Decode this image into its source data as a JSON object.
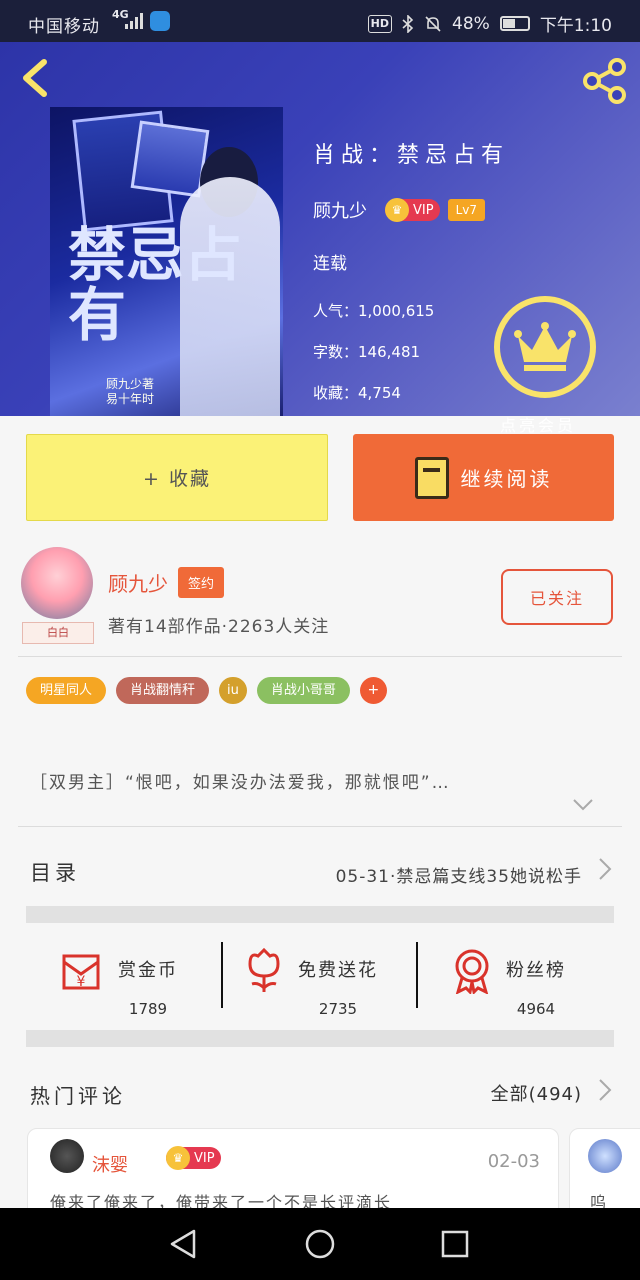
{
  "status_bar": {
    "carrier": "中国移动",
    "network": "4G",
    "battery": "48%",
    "time": "下午1:10"
  },
  "book": {
    "title": "肖战：禁忌占有",
    "author": "顾九少",
    "vip_label": "VIP",
    "level": "Lv7",
    "status": "连载",
    "popularity": "人气：1,000,615",
    "word_count": "字数：146,481",
    "favorites": "收藏：4,754",
    "cover_title": "禁忌占有",
    "cover_subtitle": "顾九少著\n易十年时"
  },
  "hero": {
    "crown_label": "点亮会员"
  },
  "actions": {
    "collect_label": "+ 收藏",
    "read_label": "继续阅读"
  },
  "author_section": {
    "name": "顾九少",
    "signed_badge": "签约",
    "avatar_tag": "白白",
    "meta": "著有14部作品·2263人关注",
    "follow_label": "已关注"
  },
  "tags": [
    {
      "label": "明星同人",
      "color": "#f5a623"
    },
    {
      "label": "肖战翻情秆",
      "color": "#c0685a"
    },
    {
      "label": "iu",
      "color": "#d4a02c"
    },
    {
      "label": "肖战小哥哥",
      "color": "#8bc061"
    },
    {
      "label": "+",
      "color": "#ef5a33"
    }
  ],
  "synopsis": "［双男主］“恨吧，如果没办法爱我，那就恨吧”…",
  "catalog": {
    "label": "目录",
    "latest": "05-31·禁忌篇支线35她说松手"
  },
  "rewards": [
    {
      "label": "赏金币",
      "count": "1789",
      "icon": "red-envelope-icon"
    },
    {
      "label": "免费送花",
      "count": "2735",
      "icon": "flower-icon"
    },
    {
      "label": "粉丝榜",
      "count": "4964",
      "icon": "medal-icon"
    }
  ],
  "comments_section": {
    "title": "热门评论",
    "all_label": "全部(494)"
  },
  "comment": {
    "user": "沫婴",
    "vip": "VIP",
    "date": "02-03",
    "text": "俺来了俺来了，俺带来了一个不是长评滴长"
  },
  "comment2": {
    "text": "呜"
  },
  "colors": {
    "accent_orange": "#f06a38",
    "collect_yellow": "#fbf277",
    "crown_yellow": "#f9e36a",
    "hero_blue": "#3a41b8"
  }
}
